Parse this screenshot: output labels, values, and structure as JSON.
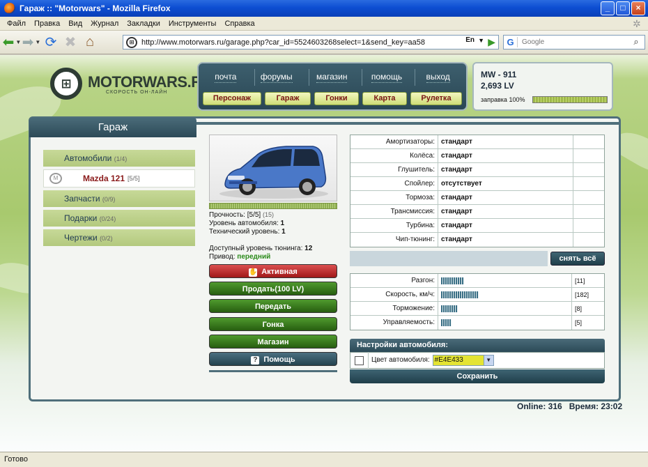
{
  "window": {
    "title": "Гараж :: \"Motorwars\" - Mozilla Firefox"
  },
  "menu": [
    "Файл",
    "Правка",
    "Вид",
    "Журнал",
    "Закладки",
    "Инструменты",
    "Справка"
  ],
  "address": {
    "url": "http://www.motorwars.ru/garage.php?car_id=5524603268select=1&send_key=aa58",
    "lang": "En"
  },
  "search": {
    "engine_letter": "G",
    "placeholder": "Google"
  },
  "status": "Готово",
  "logo": {
    "name": "MOTORWARS.RU",
    "tagline": "СКОРОСТЬ ОН-ЛАЙН",
    "mark": "⊞"
  },
  "topnav": {
    "links": [
      "почта",
      "форумы",
      "магазин",
      "помощь",
      "выход"
    ],
    "buttons": [
      "Персонаж",
      "Гараж",
      "Гонки",
      "Карта",
      "Рулетка"
    ]
  },
  "account": {
    "line1": "MW - 911",
    "line2": "2,693 LV",
    "fuel_label": "заправка 100%",
    "fuel_percent": 100
  },
  "panel_title": "Гараж",
  "sidenav": {
    "cars": {
      "label": "Автомобили",
      "count": "(1/4)"
    },
    "car_item": {
      "name": "Mazda 121",
      "count": "[5/5]",
      "icon": "mazda-logo-icon"
    },
    "parts": {
      "label": "Запчасти",
      "count": "(0/9)"
    },
    "gifts": {
      "label": "Подарки",
      "count": "(0/24)"
    },
    "blueprints": {
      "label": "Чертежи",
      "count": "(0/2)"
    }
  },
  "car": {
    "durability_label": "Прочность:",
    "durability_value": "[5/5]",
    "durability_extra": "(15)",
    "level_label": "Уровень автомобиля:",
    "level_value": "1",
    "tech_label": "Технический уровень:",
    "tech_value": "1",
    "tuning_label": "Доступный уровень тюнинга:",
    "tuning_value": "12",
    "drive_label": "Привод:",
    "drive_value": "передний"
  },
  "actions": {
    "active": "Активная",
    "sell": "Продать(100 LV)",
    "transfer": "Передать",
    "race": "Гонка",
    "shop": "Магазин",
    "help": "Помощь"
  },
  "parts_table": [
    {
      "name": "Амортизаторы:",
      "value": "стандарт"
    },
    {
      "name": "Колёса:",
      "value": "стандарт"
    },
    {
      "name": "Глушитель:",
      "value": "стандарт"
    },
    {
      "name": "Спойлер:",
      "value": "отсутствует"
    },
    {
      "name": "Тормоза:",
      "value": "стандарт"
    },
    {
      "name": "Трансмиссия:",
      "value": "стандарт"
    },
    {
      "name": "Турбина:",
      "value": "стандарт"
    },
    {
      "name": "Чип-тюнинг:",
      "value": "стандарт"
    }
  ],
  "remove_all": "снять всё",
  "stats": [
    {
      "name": "Разгон:",
      "value": "[11]",
      "level": 11
    },
    {
      "name": "Скорость, км/ч:",
      "value": "[182]",
      "level": 18
    },
    {
      "name": "Торможение:",
      "value": "[8]",
      "level": 8
    },
    {
      "name": "Управляемость:",
      "value": "[5]",
      "level": 5
    }
  ],
  "settings": {
    "title": "Настройки автомобиля:",
    "color_label": "Цвет автомобиля:",
    "color_value": "#E4E433",
    "save": "Сохранить"
  },
  "footer": {
    "online": "Online: 316",
    "time": "Время: 23:02"
  }
}
